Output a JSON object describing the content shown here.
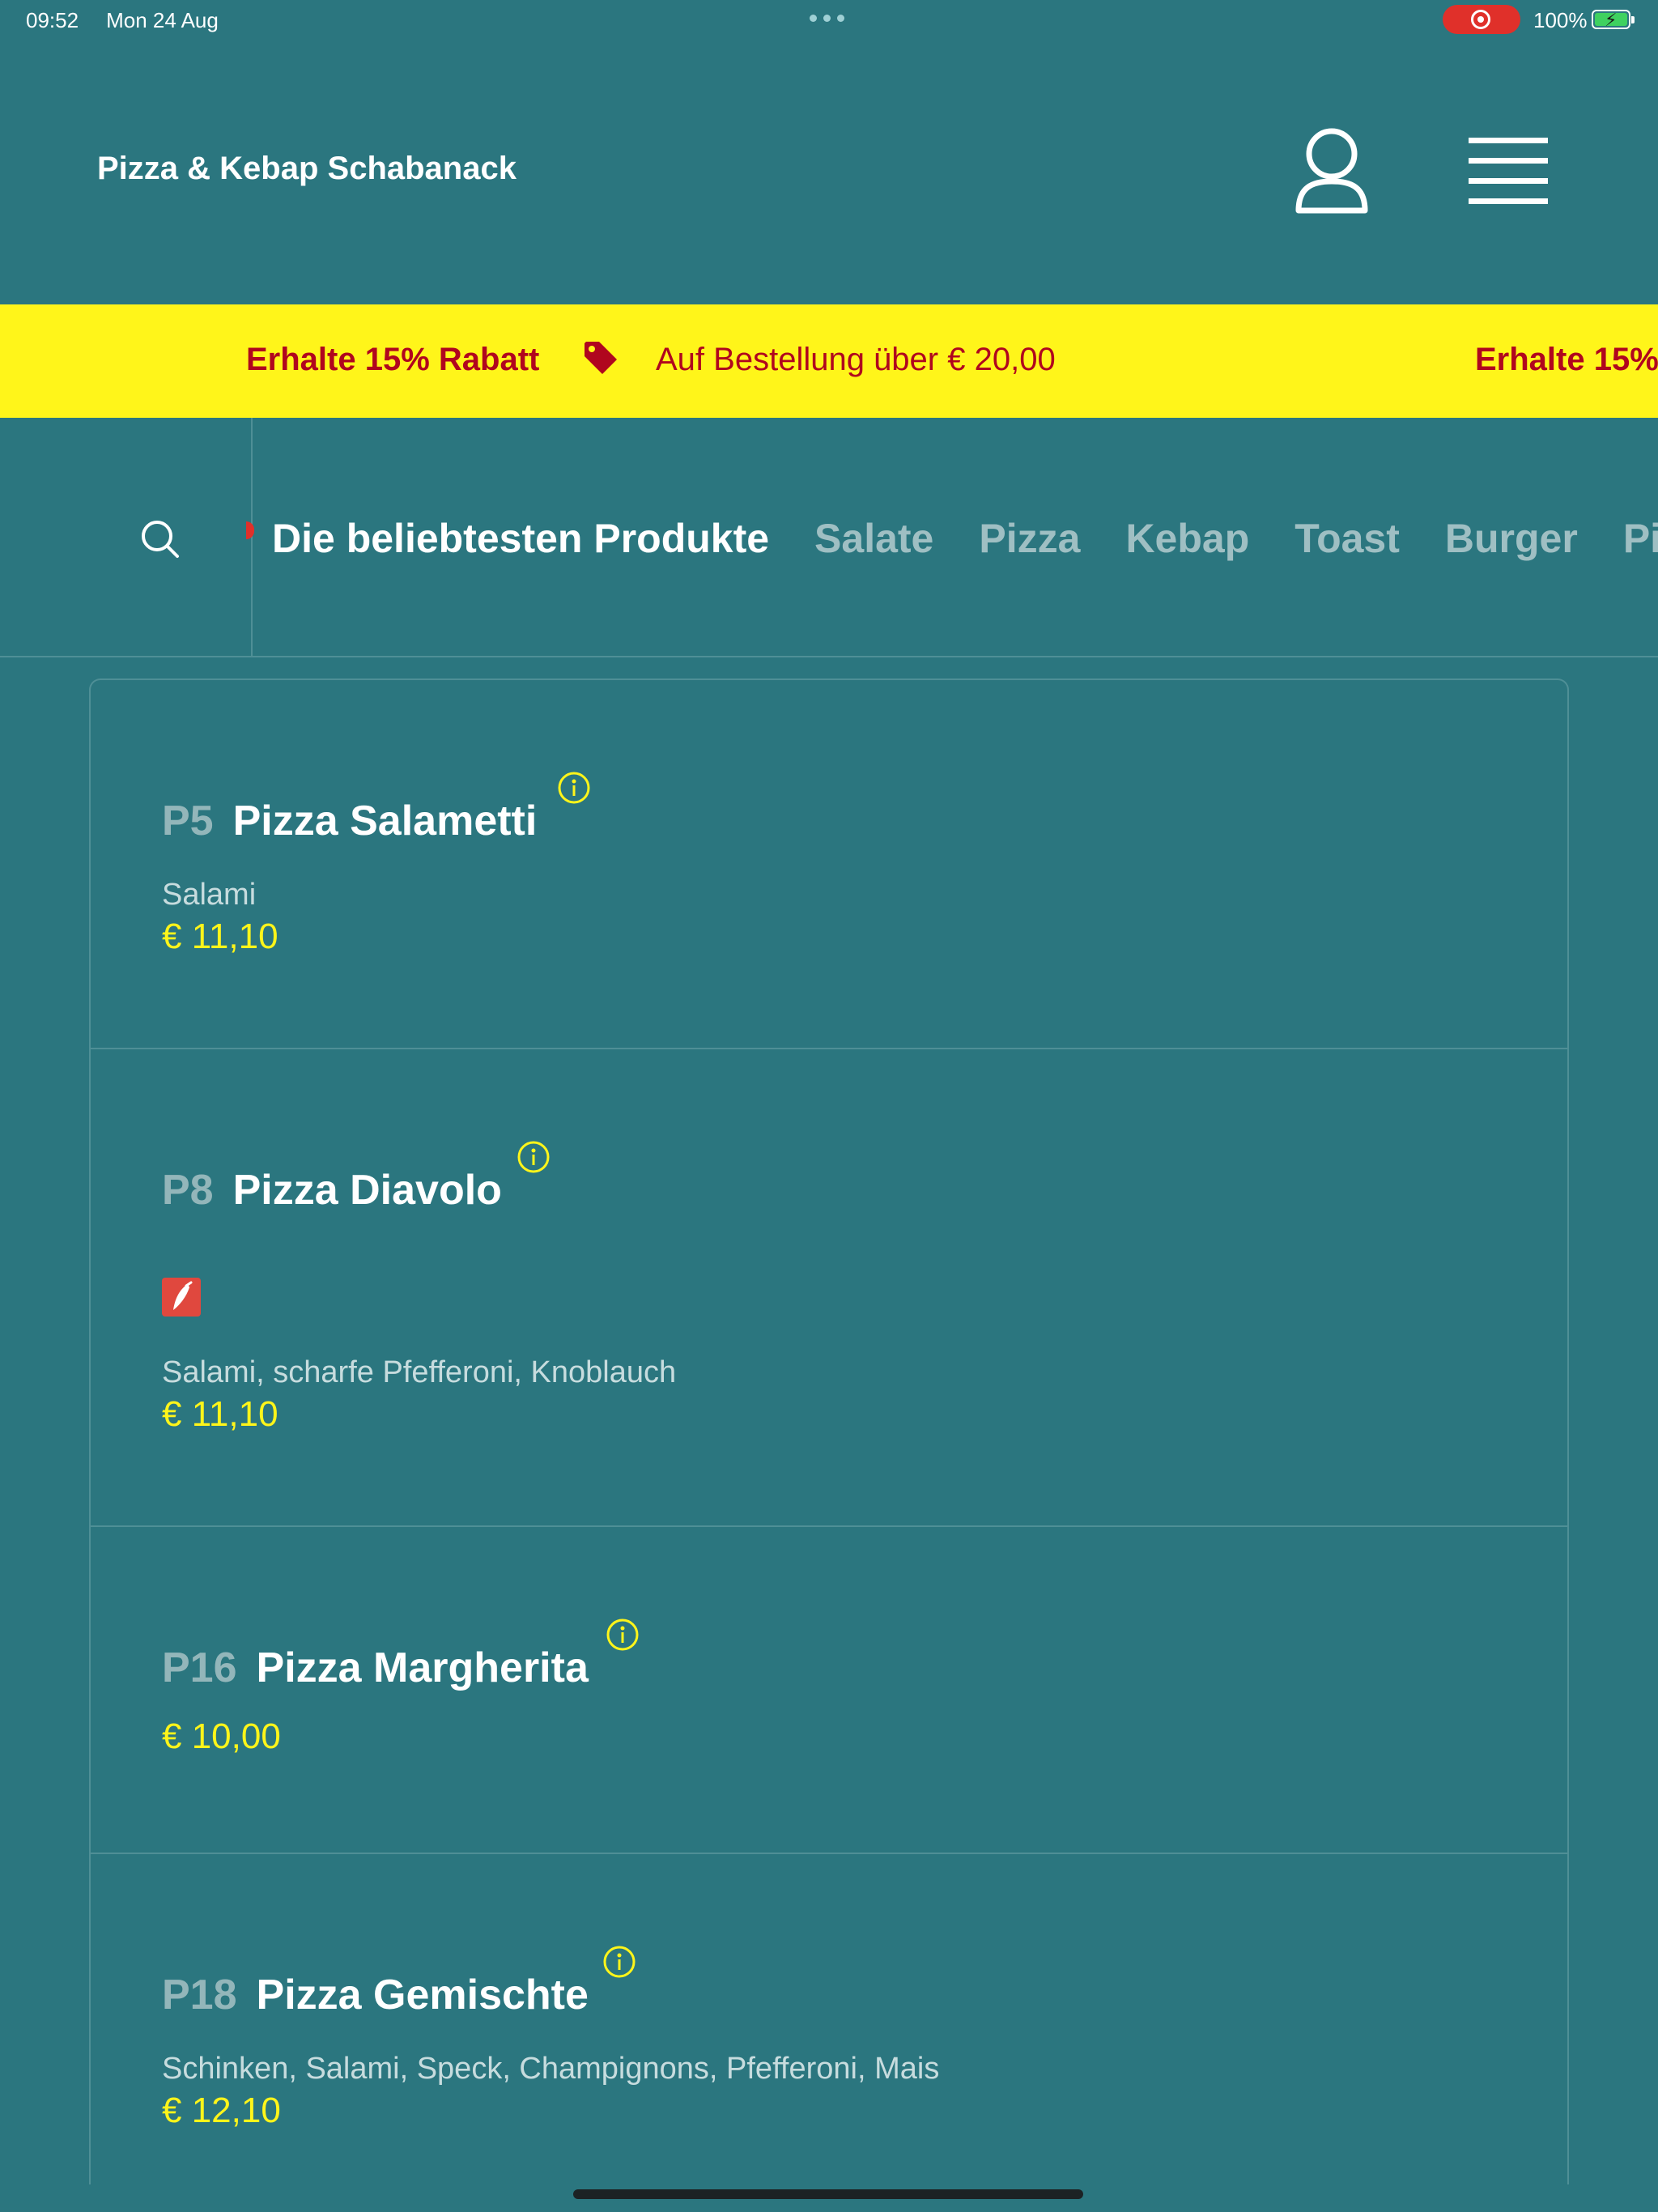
{
  "status_bar": {
    "time": "09:52",
    "date": "Mon 24 Aug",
    "battery": "100%"
  },
  "header": {
    "brand": "Pizza & Kebap Schabanack",
    "user_icon": "user-icon",
    "menu_icon": "hamburger-menu-icon"
  },
  "promo": {
    "headline": "Erhalte 15% Rabatt",
    "condition": "Auf Bestellung über € 20,00",
    "headline_repeat": "Erhalte 15%",
    "tag_icon": "price-tag-icon"
  },
  "categories": {
    "items": [
      "Die beliebtesten Produkte",
      "Salate",
      "Pizza",
      "Kebap",
      "Toast",
      "Burger",
      "Pide"
    ],
    "active_index": 0
  },
  "products": [
    {
      "code": "P5",
      "name": "Pizza Salametti",
      "description": "Salami",
      "price": "€ 11,10",
      "spicy": false
    },
    {
      "code": "P8",
      "name": "Pizza Diavolo",
      "description": "Salami, scharfe Pfefferoni, Knoblauch",
      "price": "€ 11,10",
      "spicy": true
    },
    {
      "code": "P16",
      "name": "Pizza Margherita",
      "description": "",
      "price": "€ 10,00",
      "spicy": false
    },
    {
      "code": "P18",
      "name": "Pizza Gemischte",
      "description": "Schinken, Salami, Speck, Champignons, Pfefferoni, Mais",
      "price": "€ 12,10",
      "spicy": false
    }
  ],
  "colors": {
    "background": "#2b767f",
    "promo_bg": "#fff51a",
    "promo_text": "#b0061e",
    "price": "#fff51a",
    "spicy_badge": "#e0483e"
  }
}
